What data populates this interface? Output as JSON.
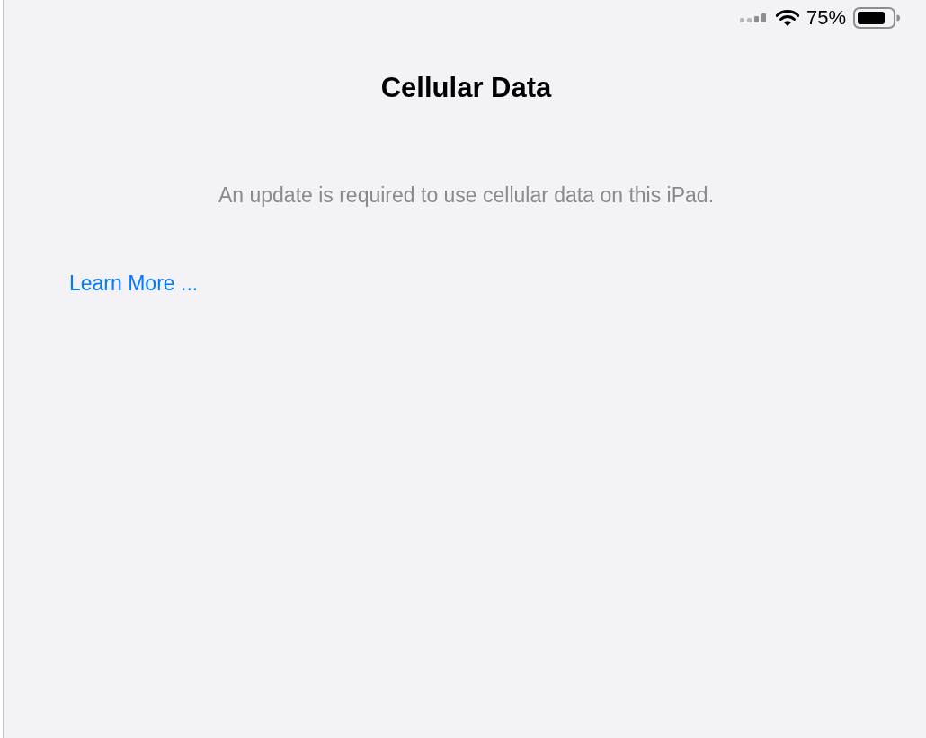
{
  "status_bar": {
    "battery_percent": "75%"
  },
  "title": "Cellular Data",
  "message": "An update is required to use cellular data on this iPad.",
  "link": "Learn More ..."
}
